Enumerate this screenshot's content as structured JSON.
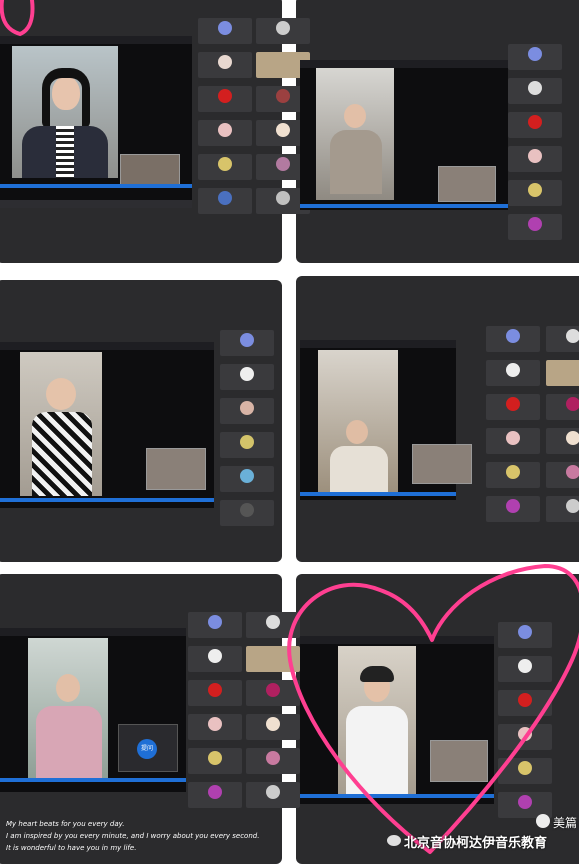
{
  "caption": {
    "line1": "My heart beats for you every day.",
    "line2": "I am inspired by you every minute, and I worry about you every second.",
    "line3": "It is wonderful to have you in my life."
  },
  "watermark": {
    "brand": "北京音协柯达伊音乐教育",
    "corner": "美篇"
  },
  "popup": {
    "button": "提问"
  },
  "colors": {
    "heart": "#ff3f91",
    "tile_bg": "#2b2b2d",
    "accent_blue": "#1f6fd6"
  },
  "icons": [
    "wechat-icon",
    "camera-icon",
    "heart-doodle"
  ]
}
